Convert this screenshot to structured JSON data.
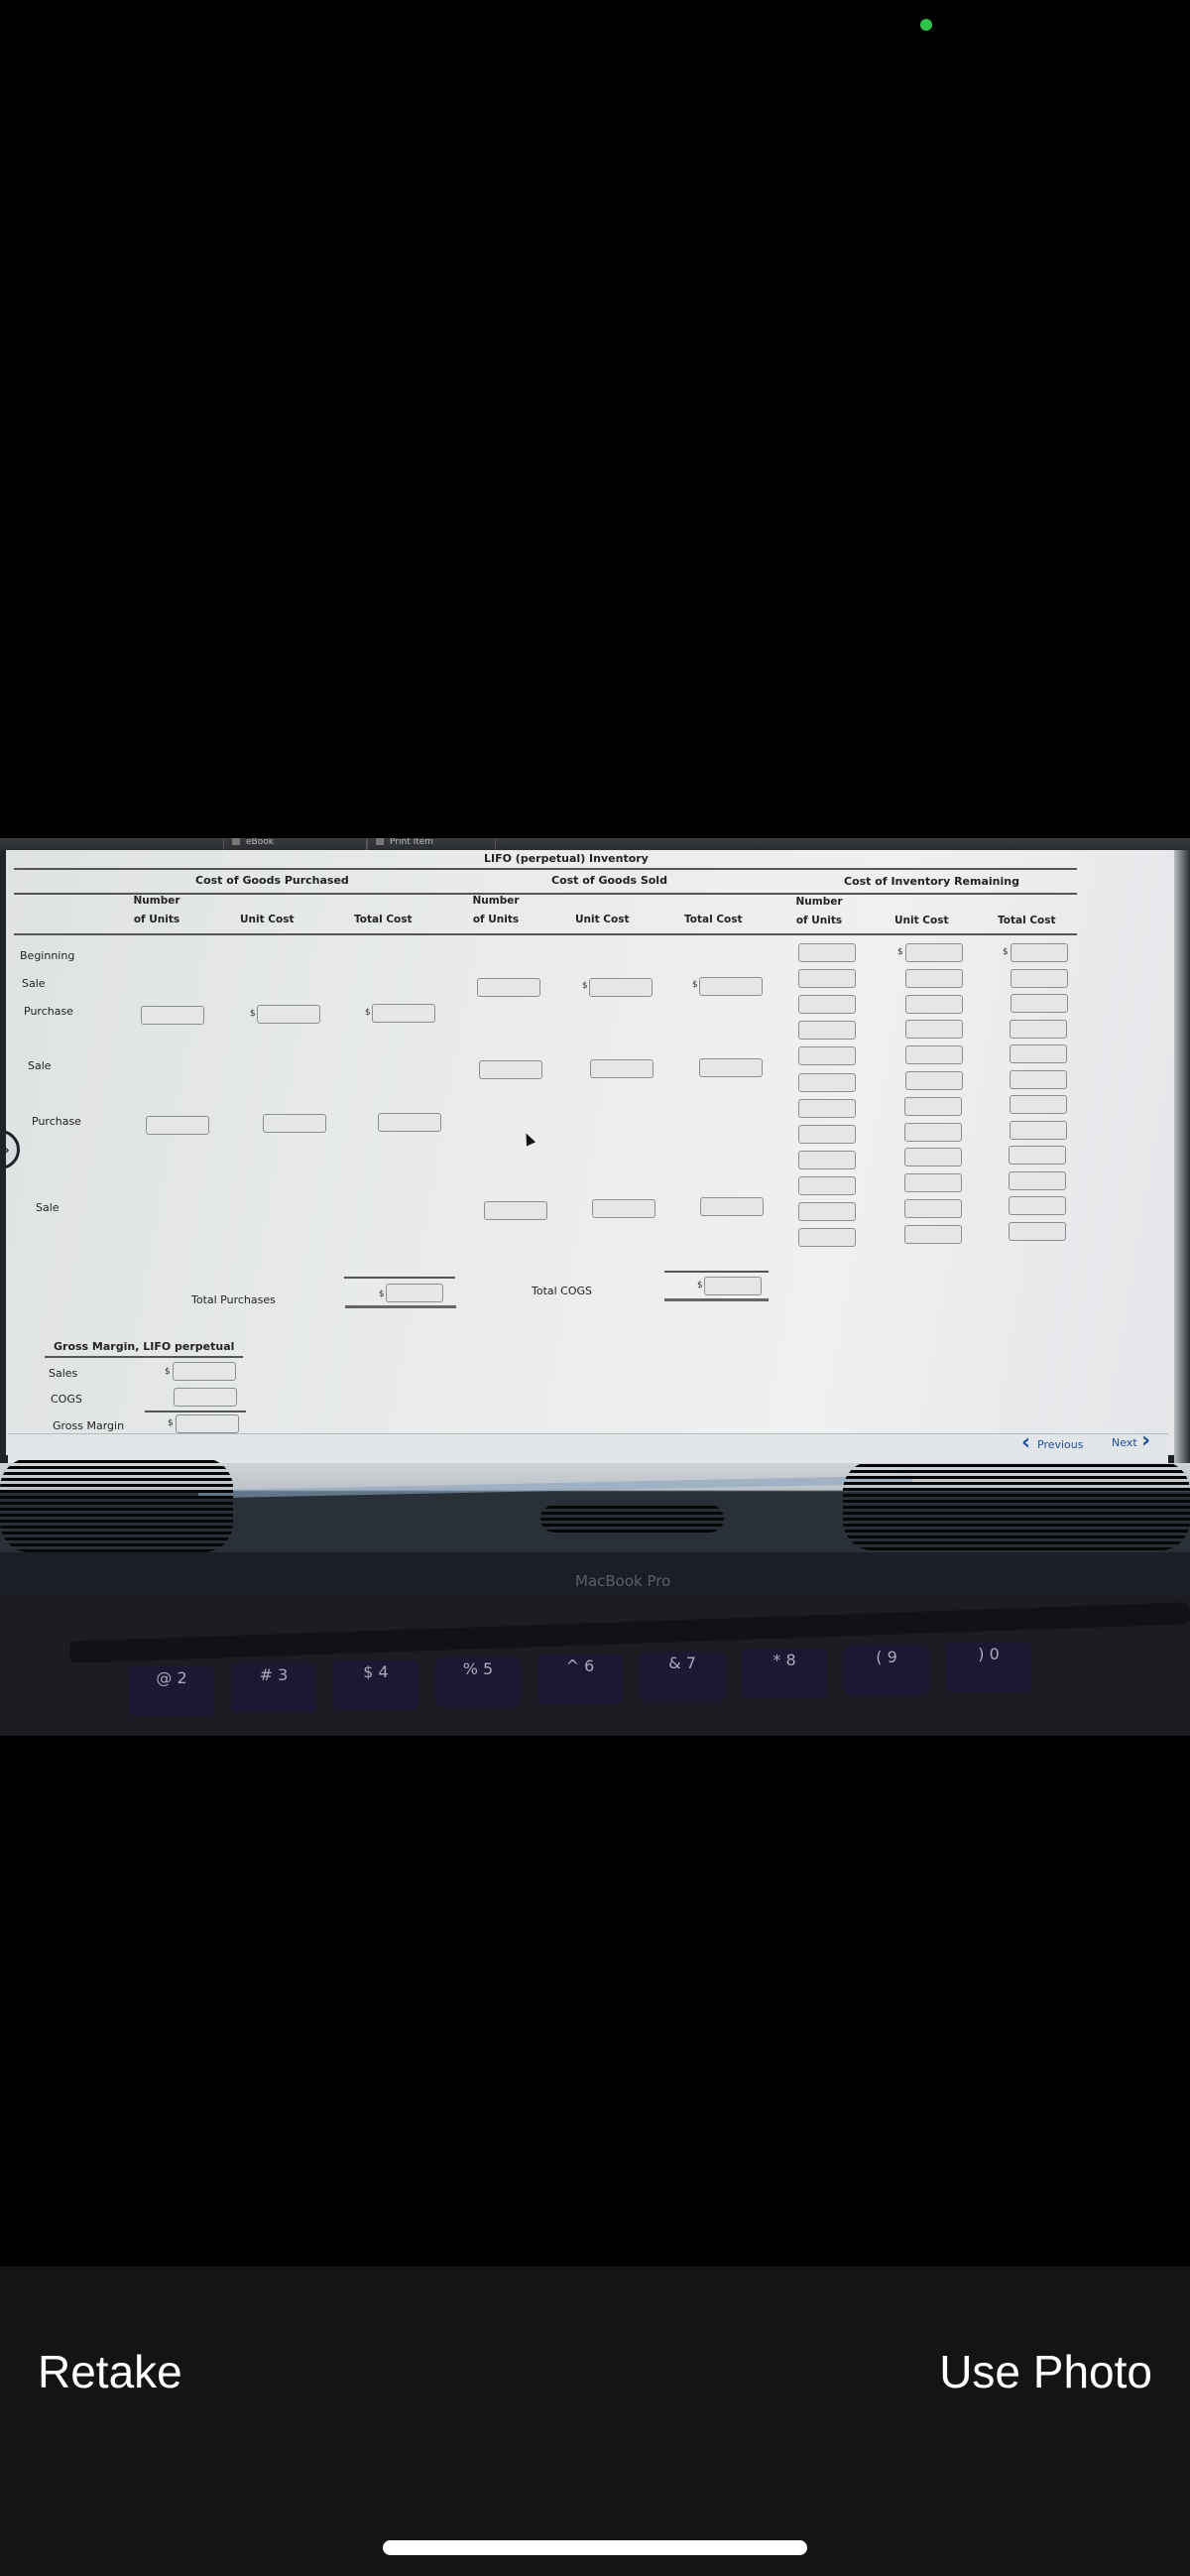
{
  "status": {
    "camera_indicator_color": "#2fc24a"
  },
  "app_toolbar": {
    "tabs": [
      {
        "label": "eBook",
        "icon": "book-icon"
      },
      {
        "label": "Print Item",
        "icon": "print-icon"
      }
    ]
  },
  "worksheet": {
    "title": "LIFO (perpetual) Inventory",
    "groups": {
      "purchased": "Cost of Goods Purchased",
      "sold": "Cost of Goods Sold",
      "remaining": "Cost of Inventory Remaining"
    },
    "columns": {
      "units_line1": "Number",
      "units_line2": "of Units",
      "unit_cost": "Unit Cost",
      "total_cost": "Total Cost"
    },
    "rows": [
      {
        "label": "Beginning"
      },
      {
        "label": "Sale"
      },
      {
        "label": "Purchase"
      },
      {
        "label": "Sale"
      },
      {
        "label": "Purchase"
      },
      {
        "label": "Sale"
      }
    ],
    "currency_symbol": "$",
    "remaining_field_rows": 12,
    "totals": {
      "purchases_label": "Total Purchases",
      "purchases_value": "",
      "cogs_label": "Total COGS",
      "cogs_value": ""
    },
    "gross_margin": {
      "title": "Gross Margin, LIFO perpetual",
      "sales_label": "Sales",
      "cogs_label": "COGS",
      "gross_margin_label": "Gross Margin",
      "sales_value": "",
      "cogs_value": "",
      "gross_margin_value": ""
    }
  },
  "navigation": {
    "previous_label": "Previous",
    "next_label": "Next"
  },
  "laptop": {
    "brand": "MacBook Pro"
  },
  "keys": [
    "@ 2",
    "# 3",
    "$ 4",
    "% 5",
    "^ 6",
    "& 7",
    "* 8",
    "( 9",
    ") 0"
  ],
  "camera_controls": {
    "retake_label": "Retake",
    "use_photo_label": "Use Photo"
  }
}
